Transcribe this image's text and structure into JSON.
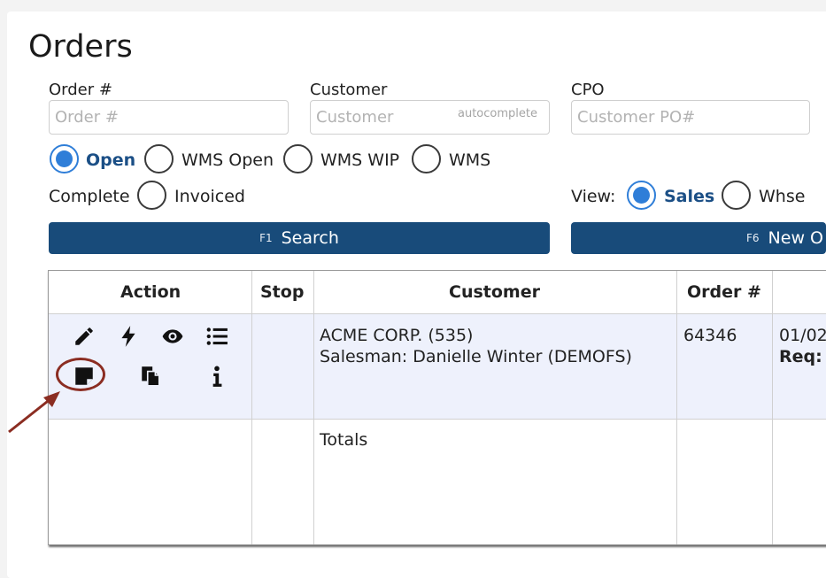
{
  "page": {
    "title": "Orders"
  },
  "filters": {
    "order_number": {
      "label": "Order #",
      "placeholder": "Order #",
      "value": ""
    },
    "customer": {
      "label": "Customer",
      "placeholder": "Customer",
      "value": "",
      "hint": "autocomplete"
    },
    "cpo": {
      "label": "CPO",
      "placeholder": "Customer PO#",
      "value": ""
    }
  },
  "status_options": [
    {
      "label": "Open",
      "selected": true
    },
    {
      "label": "WMS Open",
      "selected": false
    },
    {
      "label": "WMS WIP",
      "selected": false
    },
    {
      "label": "WMS",
      "selected": false
    },
    {
      "label": "Complete",
      "selected": false
    },
    {
      "label": "Invoiced",
      "selected": false
    }
  ],
  "view": {
    "label": "View:",
    "options": [
      {
        "label": "Sales",
        "selected": true
      },
      {
        "label": "Whse",
        "selected": false
      }
    ]
  },
  "buttons": {
    "search": {
      "key": "F1",
      "label": "Search"
    },
    "new_order": {
      "key": "F6",
      "label": "New O"
    }
  },
  "table": {
    "headers": [
      "Action",
      "Stop",
      "Customer",
      "Order #",
      ""
    ],
    "rows": [
      {
        "customer_line1": "ACME CORP. (535)",
        "customer_line2": "Salesman: Danielle Winter (DEMOFS)",
        "order_number": "64346",
        "date": "01/02",
        "req_label": "Req:"
      }
    ],
    "totals_label": "Totals",
    "action_icons": [
      "pencil-icon",
      "bolt-icon",
      "eye-icon",
      "list-icon",
      "note-icon",
      "copy-icon",
      "info-icon"
    ]
  },
  "colors": {
    "primary_button": "#184b7a",
    "radio_selected": "#2f7ed8",
    "row_highlight": "#eef1fc",
    "annotation": "#8b2d22"
  }
}
